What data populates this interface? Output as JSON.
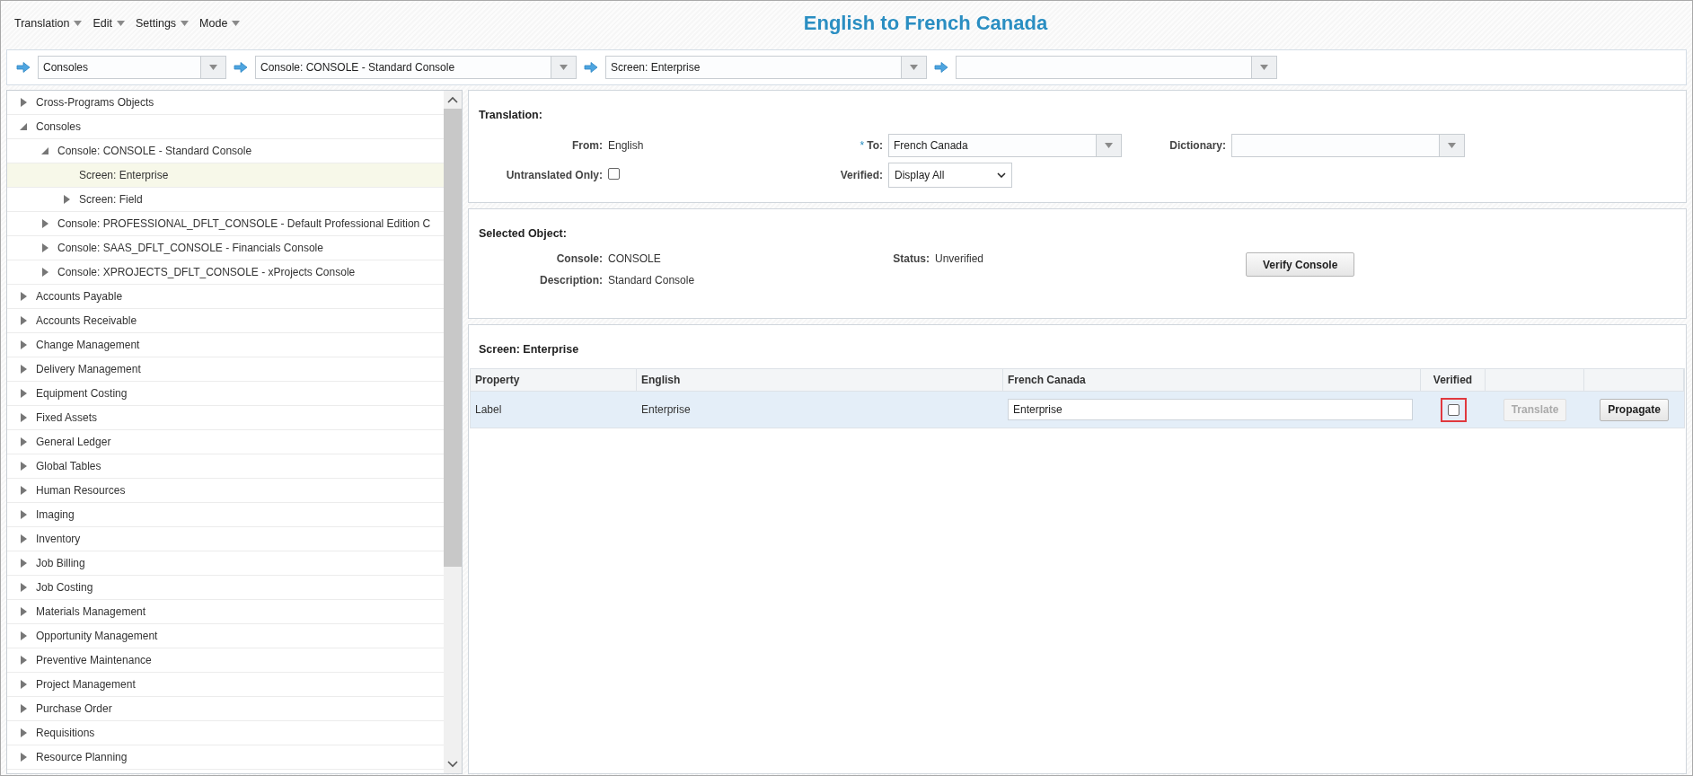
{
  "menu": [
    {
      "label": "Translation"
    },
    {
      "label": "Edit"
    },
    {
      "label": "Settings"
    },
    {
      "label": "Mode"
    }
  ],
  "title": "English to French Canada",
  "path": [
    {
      "kind": "filled",
      "value": "Consoles"
    },
    {
      "kind": "filled",
      "value": "Console: CONSOLE - Standard Console"
    },
    {
      "kind": "filled",
      "value": "Screen: Enterprise"
    },
    {
      "kind": "empty"
    }
  ],
  "tree": [
    {
      "label": "Cross-Programs Objects",
      "kind": "branch",
      "expanded": false,
      "selected": false
    },
    {
      "label": "Consoles",
      "kind": "branch",
      "expanded": true,
      "selected": false,
      "children": [
        {
          "label": "Console: CONSOLE - Standard Console",
          "kind": "branch",
          "expanded": true,
          "selected": false,
          "children": [
            {
              "label": "Screen: Enterprise",
              "kind": "leaf",
              "selected": true
            },
            {
              "label": "Screen: Field",
              "kind": "branch",
              "expanded": false,
              "selected": false
            }
          ]
        },
        {
          "label": "Console: PROFESSIONAL_DFLT_CONSOLE - Default Professional Edition C",
          "kind": "branch",
          "expanded": false,
          "selected": false
        },
        {
          "label": "Console: SAAS_DFLT_CONSOLE - Financials Console",
          "kind": "branch",
          "expanded": false,
          "selected": false
        },
        {
          "label": "Console: XPROJECTS_DFLT_CONSOLE - xProjects Console",
          "kind": "branch",
          "expanded": false,
          "selected": false
        }
      ]
    },
    {
      "label": "Accounts Payable",
      "kind": "branch",
      "expanded": false,
      "selected": false
    },
    {
      "label": "Accounts Receivable",
      "kind": "branch",
      "expanded": false,
      "selected": false
    },
    {
      "label": "Change Management",
      "kind": "branch",
      "expanded": false,
      "selected": false
    },
    {
      "label": "Delivery Management",
      "kind": "branch",
      "expanded": false,
      "selected": false
    },
    {
      "label": "Equipment Costing",
      "kind": "branch",
      "expanded": false,
      "selected": false
    },
    {
      "label": "Fixed Assets",
      "kind": "branch",
      "expanded": false,
      "selected": false
    },
    {
      "label": "General Ledger",
      "kind": "branch",
      "expanded": false,
      "selected": false
    },
    {
      "label": "Global Tables",
      "kind": "branch",
      "expanded": false,
      "selected": false
    },
    {
      "label": "Human Resources",
      "kind": "branch",
      "expanded": false,
      "selected": false
    },
    {
      "label": "Imaging",
      "kind": "branch",
      "expanded": false,
      "selected": false
    },
    {
      "label": "Inventory",
      "kind": "branch",
      "expanded": false,
      "selected": false
    },
    {
      "label": "Job Billing",
      "kind": "branch",
      "expanded": false,
      "selected": false
    },
    {
      "label": "Job Costing",
      "kind": "branch",
      "expanded": false,
      "selected": false
    },
    {
      "label": "Materials Management",
      "kind": "branch",
      "expanded": false,
      "selected": false
    },
    {
      "label": "Opportunity Management",
      "kind": "branch",
      "expanded": false,
      "selected": false
    },
    {
      "label": "Preventive Maintenance",
      "kind": "branch",
      "expanded": false,
      "selected": false
    },
    {
      "label": "Project Management",
      "kind": "branch",
      "expanded": false,
      "selected": false
    },
    {
      "label": "Purchase Order",
      "kind": "branch",
      "expanded": false,
      "selected": false
    },
    {
      "label": "Requisitions",
      "kind": "branch",
      "expanded": false,
      "selected": false
    },
    {
      "label": "Resource Planning",
      "kind": "branch",
      "expanded": false,
      "selected": false
    }
  ],
  "translation": {
    "title": "Translation:",
    "from": {
      "label": "From:",
      "value": "English"
    },
    "untranslated_only": {
      "label": "Untranslated Only:",
      "checked": false
    },
    "to": {
      "required_mark": "*",
      "label": "To:",
      "value": "French Canada"
    },
    "verified": {
      "label": "Verified:",
      "value": "Display All"
    },
    "dictionary": {
      "label": "Dictionary:"
    }
  },
  "selected_object": {
    "title": "Selected Object:",
    "fields": [
      {
        "label": "Console:",
        "value": "CONSOLE"
      },
      {
        "label": "Description:",
        "value": "Standard Console"
      }
    ],
    "status": {
      "label": "Status:",
      "value": "Unverified"
    },
    "button": "Verify Console"
  },
  "screen": {
    "title": "Screen: Enterprise",
    "columns": [
      {
        "label": "Property"
      },
      {
        "label": "English"
      },
      {
        "label": "French Canada"
      },
      {
        "label": "Verified"
      }
    ],
    "rows": [
      {
        "property": "Label",
        "english": "Enterprise",
        "translation": "Enterprise",
        "verified": false,
        "highlighted": true,
        "selected": true,
        "translate": {
          "label": "Translate",
          "disabled": true
        },
        "propagate": {
          "label": "Propagate",
          "disabled": false
        }
      }
    ]
  }
}
